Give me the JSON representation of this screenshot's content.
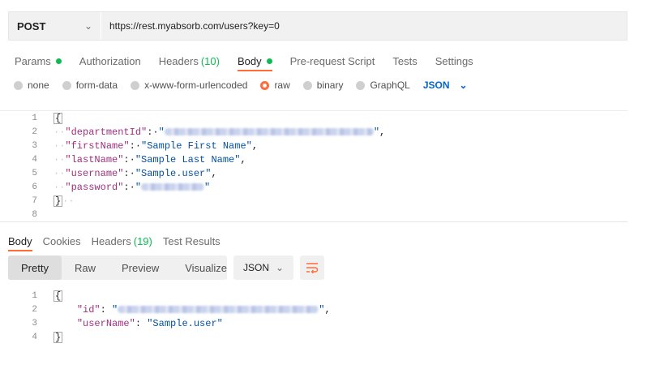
{
  "request": {
    "method": "POST",
    "url": "https://rest.myabsorb.com/users?key=0"
  },
  "tabs": [
    {
      "label": "Params",
      "dot": true
    },
    {
      "label": "Authorization"
    },
    {
      "label": "Headers",
      "count": "(10)"
    },
    {
      "label": "Body",
      "dot": true,
      "active": true
    },
    {
      "label": "Pre-request Script"
    },
    {
      "label": "Tests"
    },
    {
      "label": "Settings"
    }
  ],
  "body_types": {
    "options": [
      "none",
      "form-data",
      "x-www-form-urlencoded",
      "raw",
      "binary",
      "GraphQL"
    ],
    "selected": "raw",
    "format": "JSON"
  },
  "request_body": {
    "line_numbers": [
      "1",
      "2",
      "3",
      "4",
      "5",
      "6",
      "7",
      "8"
    ],
    "open": "{",
    "close": "}",
    "departmentId_key": "\"departmentId\"",
    "firstName_key": "\"firstName\"",
    "firstName_val": "\"Sample First Name\"",
    "lastName_key": "\"lastName\"",
    "lastName_val": "\"Sample Last Name\"",
    "username_key": "\"username\"",
    "username_val": "\"Sample.user\"",
    "password_key": "\"password\""
  },
  "response": {
    "tabs": [
      {
        "label": "Body",
        "active": true
      },
      {
        "label": "Cookies"
      },
      {
        "label": "Headers",
        "count": "(19)"
      },
      {
        "label": "Test Results"
      }
    ],
    "views": [
      "Pretty",
      "Raw",
      "Preview",
      "Visualize"
    ],
    "active_view": "Pretty",
    "format": "JSON",
    "line_numbers": [
      "1",
      "2",
      "3",
      "4"
    ],
    "open": "{",
    "close": "}",
    "id_key": "\"id\"",
    "userName_key": "\"userName\"",
    "userName_val": "\"Sample.user\""
  },
  "colors": {
    "accent": "#ff6c37",
    "dot_green": "#0cbb52",
    "json_blue": "#0265d2",
    "key_color": "#a0307f",
    "string_color": "#0451a5"
  }
}
